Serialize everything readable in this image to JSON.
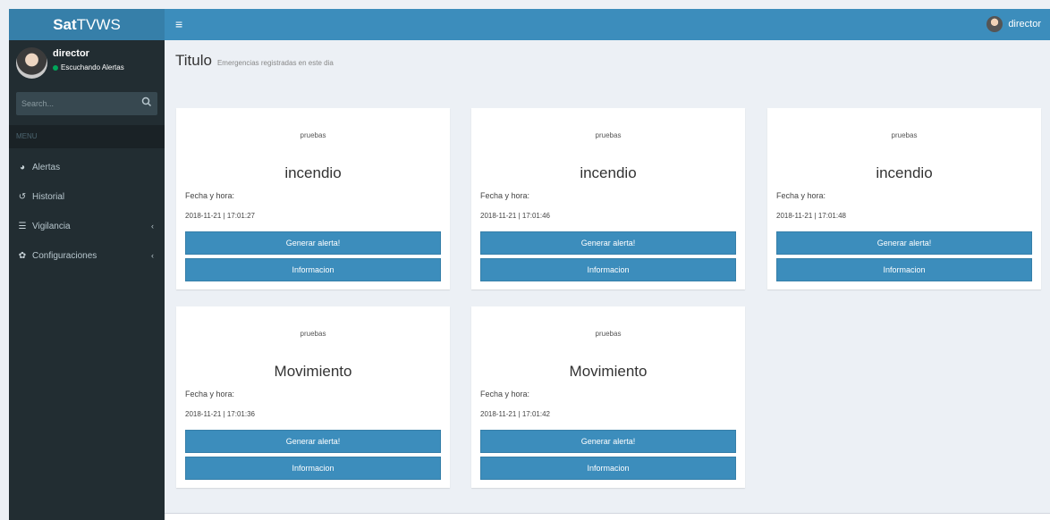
{
  "app": {
    "logo_bold": "Sat",
    "logo_rest": "TVWS"
  },
  "navbar": {
    "toggle_icon": "hamburger-icon",
    "user_name": "director"
  },
  "sidebar": {
    "user_name": "director",
    "user_status": "Escuchando Alertas",
    "search_placeholder": "Search...",
    "menu_header": "MENU",
    "items": [
      {
        "label": "Alertas",
        "icon": "dashboard-icon",
        "has_children": false
      },
      {
        "label": "Historial",
        "icon": "history-icon",
        "has_children": false
      },
      {
        "label": "Vigilancia",
        "icon": "list-icon",
        "has_children": true
      },
      {
        "label": "Configuraciones",
        "icon": "gear-icon",
        "has_children": true
      }
    ]
  },
  "content": {
    "title": "Titulo",
    "subtitle": "Emergencias registradas en este dia"
  },
  "cards": [
    {
      "label": "pruebas",
      "type": "incendio",
      "date_label": "Fecha y hora:",
      "datetime": "2018-11-21 | 17:01:27",
      "primary_button": "Generar alerta!",
      "secondary_button": "Informacion"
    },
    {
      "label": "pruebas",
      "type": "incendio",
      "date_label": "Fecha y hora:",
      "datetime": "2018-11-21 | 17:01:46",
      "primary_button": "Generar alerta!",
      "secondary_button": "Informacion"
    },
    {
      "label": "pruebas",
      "type": "incendio",
      "date_label": "Fecha y hora:",
      "datetime": "2018-11-21 | 17:01:48",
      "primary_button": "Generar alerta!",
      "secondary_button": "Informacion"
    },
    {
      "label": "pruebas",
      "type": "Movimiento",
      "date_label": "Fecha y hora:",
      "datetime": "2018-11-21 | 17:01:36",
      "primary_button": "Generar alerta!",
      "secondary_button": "Informacion"
    },
    {
      "label": "pruebas",
      "type": "Movimiento",
      "date_label": "Fecha y hora:",
      "datetime": "2018-11-21 | 17:01:42",
      "primary_button": "Generar alerta!",
      "secondary_button": "Informacion"
    }
  ],
  "colors": {
    "primary": "#3c8dbc",
    "logo_bg": "#367fa9",
    "sidebar_bg": "#222d32",
    "status_online": "#00a65a",
    "content_bg": "#ecf0f5"
  }
}
